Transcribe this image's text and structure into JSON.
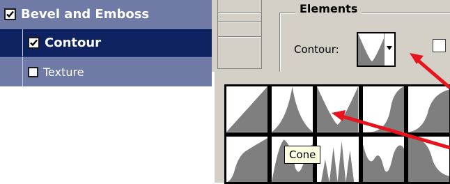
{
  "style_list": {
    "items": [
      {
        "label": "Bevel and Emboss",
        "checked": true,
        "selected": false
      },
      {
        "label": "Contour",
        "checked": true,
        "selected": true
      },
      {
        "label": "Texture",
        "checked": false,
        "selected": false
      }
    ]
  },
  "dialog": {
    "group_title": "Elements",
    "contour_label": "Contour:",
    "contour_value_icon": "cone-contour-icon"
  },
  "palette": {
    "presets": [
      "linear-contour-icon",
      "peak-contour-icon",
      "cone-contour-icon",
      "s-curve-contour-icon",
      "half-round-contour-icon",
      "rounded-steps-contour-icon",
      "ring-contour-icon",
      "double-ring-contour-icon",
      "sawtooth-contour-icon",
      "cove-contour-icon"
    ],
    "selected_preset": "cone-contour-icon",
    "tooltip": "Cone"
  },
  "colors": {
    "list_bg": "#6f7ba6",
    "list_selected_bg": "#0e2160",
    "dialog_bg": "#d4d0c8",
    "contour_fill": "#7f7f7f",
    "annotation_arrow": "#e8131b",
    "tooltip_bg": "#ffffe1"
  }
}
